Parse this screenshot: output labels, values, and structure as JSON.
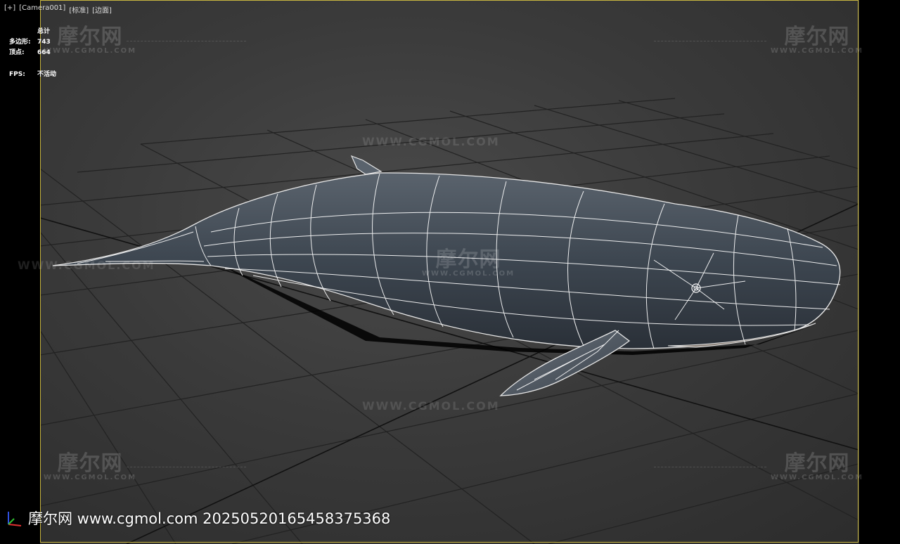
{
  "viewport": {
    "labels": [
      "[+]",
      "[Camera001]",
      "[标准]",
      "[边面]"
    ]
  },
  "stats": {
    "total_label": "总计",
    "polys_label": "多边形:",
    "polys_value": "743",
    "verts_label": "顶点:",
    "verts_value": "664",
    "fps_label": "FPS:",
    "fps_value": "不活动"
  },
  "watermark": {
    "logo_text": "摩尔网",
    "site_text": "WWW.CGMOL.COM"
  },
  "footer": {
    "text": "摩尔网 www.cgmol.com 20250520165458375368"
  },
  "colors": {
    "frame": "#c8b640",
    "whale_body": "#3d4650",
    "wireframe": "#ffffff",
    "grid": "#202020"
  }
}
